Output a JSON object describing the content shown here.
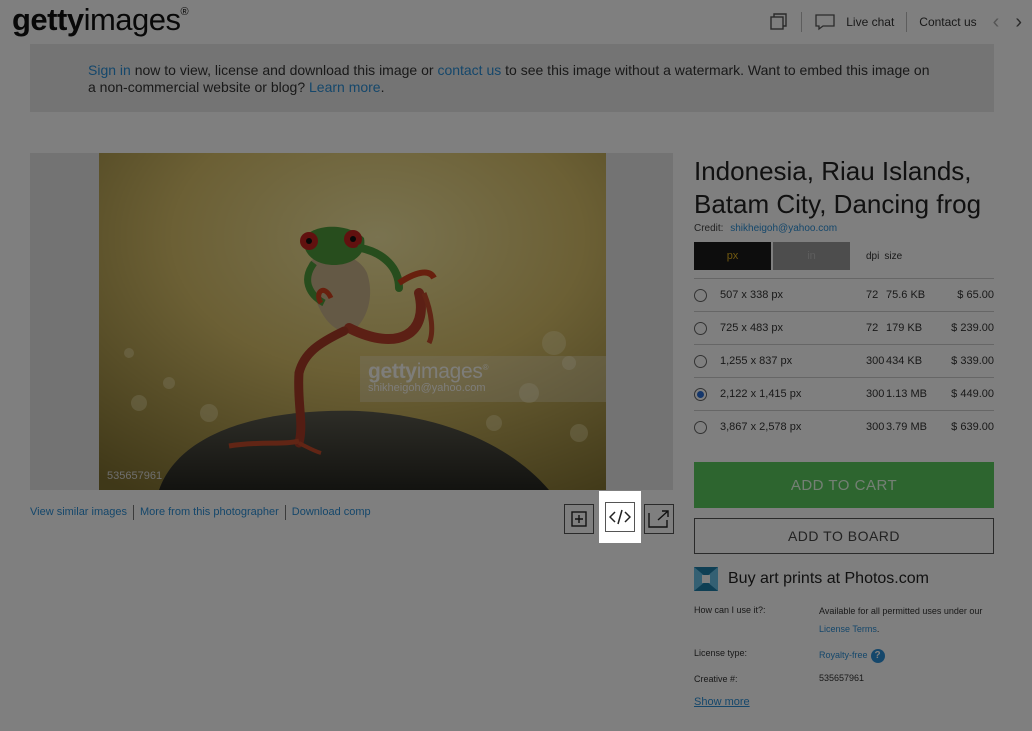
{
  "header": {
    "logo_bold": "getty",
    "logo_light": "images",
    "live_chat": "Live chat",
    "contact_us": "Contact us",
    "icons": [
      "lightbox-icon",
      "chat-bubble-icon",
      "chevron-left-icon",
      "chevron-right-icon"
    ]
  },
  "banner": {
    "sign_in": "Sign in",
    "text1": " now to view, license and download this image or ",
    "contact_us": "contact us",
    "text2": " to see this image without a watermark. Want to embed this image on a non-commercial website or blog? ",
    "learn_more": "Learn more",
    "text3": "."
  },
  "image": {
    "watermark_brand_bold": "getty",
    "watermark_brand_light": "images",
    "watermark_credit": "shikheigoh@yahoo.com",
    "image_id": "535657961"
  },
  "image_links": {
    "similar": "View similar images",
    "photographer": "More from this photographer",
    "download": "Download comp"
  },
  "tools": {
    "icons": [
      "add-to-board-icon",
      "embed-code-icon",
      "share-icon"
    ]
  },
  "details": {
    "title": "Indonesia, Riau Islands, Batam City, Dancing frog",
    "credit_label": "Credit:",
    "credit_value": "shikheigoh@yahoo.com",
    "unit_px": "px",
    "unit_in": "in",
    "col_dpi": "dpi",
    "col_size": "size",
    "sizes": [
      {
        "dim": "507 x 338 px",
        "dpi": "72",
        "size": "75.6 KB",
        "price": "$ 65.00",
        "selected": false
      },
      {
        "dim": "725 x 483 px",
        "dpi": "72",
        "size": "179 KB",
        "price": "$ 239.00",
        "selected": false
      },
      {
        "dim": "1,255 x 837 px",
        "dpi": "300",
        "size": "434 KB",
        "price": "$ 339.00",
        "selected": false
      },
      {
        "dim": "2,122 x 1,415 px",
        "dpi": "300",
        "size": "1.13 MB",
        "price": "$ 449.00",
        "selected": true
      },
      {
        "dim": "3,867 x 2,578 px",
        "dpi": "300",
        "size": "3.79 MB",
        "price": "$ 639.00",
        "selected": false
      }
    ],
    "add_to_cart": "ADD TO CART",
    "add_to_board": "ADD TO BOARD",
    "buy_prints": "Buy art prints at Photos.com",
    "use_label": "How can I use it?:",
    "use_text": "Available for all permitted uses under our ",
    "license_terms": "License Terms",
    "use_text_end": ".",
    "license_type_label": "License type:",
    "license_type_value": "Royalty-free",
    "help_glyph": "?",
    "creative_label": "Creative #:",
    "creative_value": "535657961",
    "show_more": "Show more"
  },
  "colors": {
    "link": "#2b8fd6",
    "cart": "#5bcb5f",
    "overlay": "rgba(0,0,0,0.5)"
  }
}
